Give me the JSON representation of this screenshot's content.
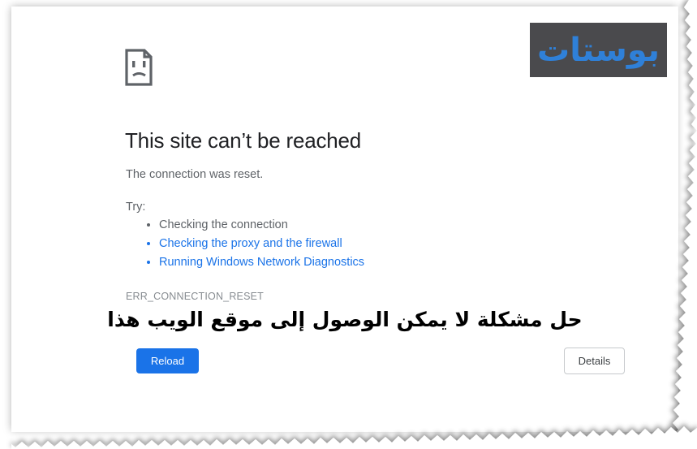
{
  "page": {
    "heading": "This site can’t be reached",
    "subtitle": "The connection was reset.",
    "try_label": "Try:",
    "suggestions": [
      {
        "label": "Checking the connection",
        "is_link": false
      },
      {
        "label": "Checking the proxy and the firewall",
        "is_link": true
      },
      {
        "label": "Running Windows Network Diagnostics",
        "is_link": true
      }
    ],
    "error_code": "ERR_CONNECTION_RESET",
    "icon": "sad-page-icon"
  },
  "buttons": {
    "reload": "Reload",
    "details": "Details"
  },
  "overlay": {
    "caption_arabic": "حل مشكلة لا يمكن الوصول إلى موقع الويب هذا"
  },
  "watermark": {
    "text": "بوستات"
  },
  "colors": {
    "link_blue": "#1a73e8",
    "button_blue": "#1a73e8",
    "heading_gray": "#202124",
    "body_gray": "#5f6368",
    "error_code_gray": "#868b90",
    "watermark_bg": "#4a4a4d",
    "watermark_text": "#2f80d8",
    "details_border": "#c6c9cc"
  }
}
